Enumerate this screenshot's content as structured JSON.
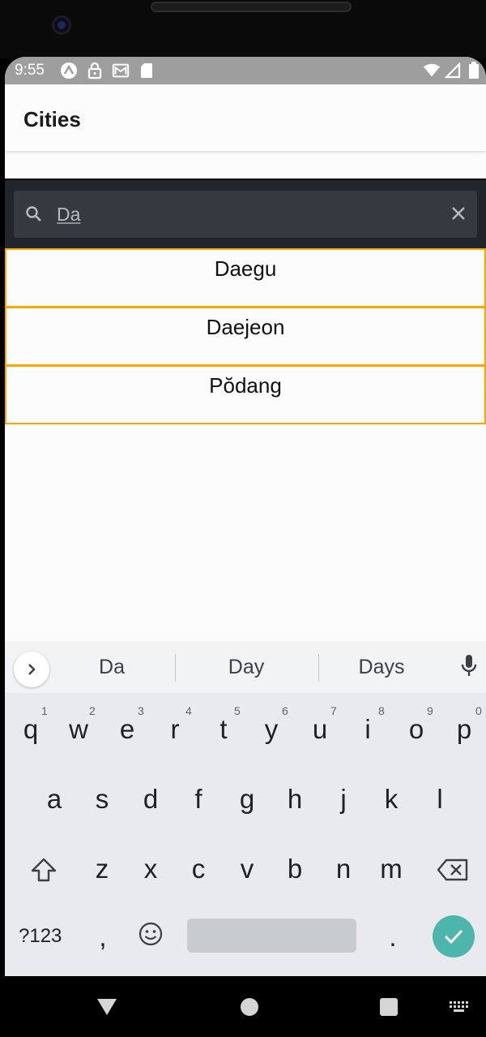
{
  "status_bar": {
    "time": "9:55"
  },
  "app_bar": {
    "title": "Cities"
  },
  "search": {
    "query": "Da"
  },
  "results": [
    "Daegu",
    "Daejeon",
    "Pŏdang"
  ],
  "keyboard": {
    "suggestions": [
      "Da",
      "Day",
      "Days"
    ],
    "row1": [
      "q",
      "w",
      "e",
      "r",
      "t",
      "y",
      "u",
      "i",
      "o",
      "p"
    ],
    "row1_hints": [
      "1",
      "2",
      "3",
      "4",
      "5",
      "6",
      "7",
      "8",
      "9",
      "0"
    ],
    "row2": [
      "a",
      "s",
      "d",
      "f",
      "g",
      "h",
      "j",
      "k",
      "l"
    ],
    "row3": [
      "z",
      "x",
      "c",
      "v",
      "b",
      "n",
      "m"
    ],
    "symbols_label": "?123",
    "comma": ",",
    "period": "."
  },
  "colors": {
    "status_bar": "#9e9e9e",
    "search_bg": "#22262b",
    "result_border": "#ffa500",
    "enter_key": "#4db6ac"
  }
}
